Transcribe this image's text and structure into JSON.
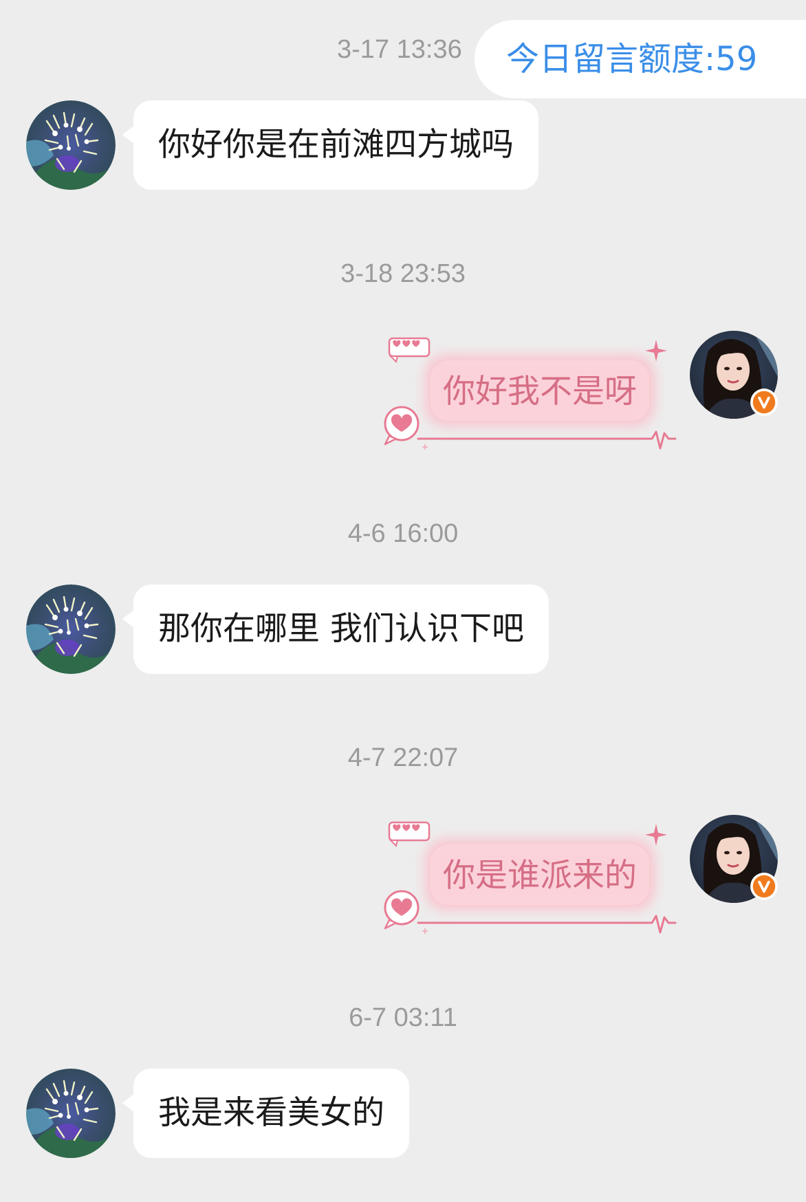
{
  "header": {
    "quota_label": "今日留言额度:59"
  },
  "colors": {
    "background": "#ededed",
    "incoming_bubble": "#ffffff",
    "outgoing_text": "#d66e85",
    "outgoing_bubble_glow": "#f9c4ce",
    "quota_text": "#3a8ee8",
    "timestamp": "#9a9a9a",
    "verified_badge": "#f07b1e"
  },
  "messages": [
    {
      "time": "3-17 13:36",
      "direction": "incoming",
      "text": "你好你是在前滩四方城吗"
    },
    {
      "time": "3-18 23:53",
      "direction": "outgoing",
      "text": "你好我不是呀"
    },
    {
      "time": "4-6 16:00",
      "direction": "incoming",
      "text": "那你在哪里 我们认识下吧"
    },
    {
      "time": "4-7 22:07",
      "direction": "outgoing",
      "text": "你是谁派来的"
    },
    {
      "time": "6-7 03:11",
      "direction": "incoming",
      "text": "我是来看美女的"
    }
  ],
  "avatars": {
    "other_user": "flower-photo-avatar",
    "self_user": "portrait-avatar",
    "self_badge": "v",
    "self_badge_icon": "verified-badge-icon"
  },
  "bubble_decor_icons": [
    "mini-hearts-icon",
    "sparkle-icon",
    "heart-speech-icon",
    "heartbeat-line-icon"
  ]
}
